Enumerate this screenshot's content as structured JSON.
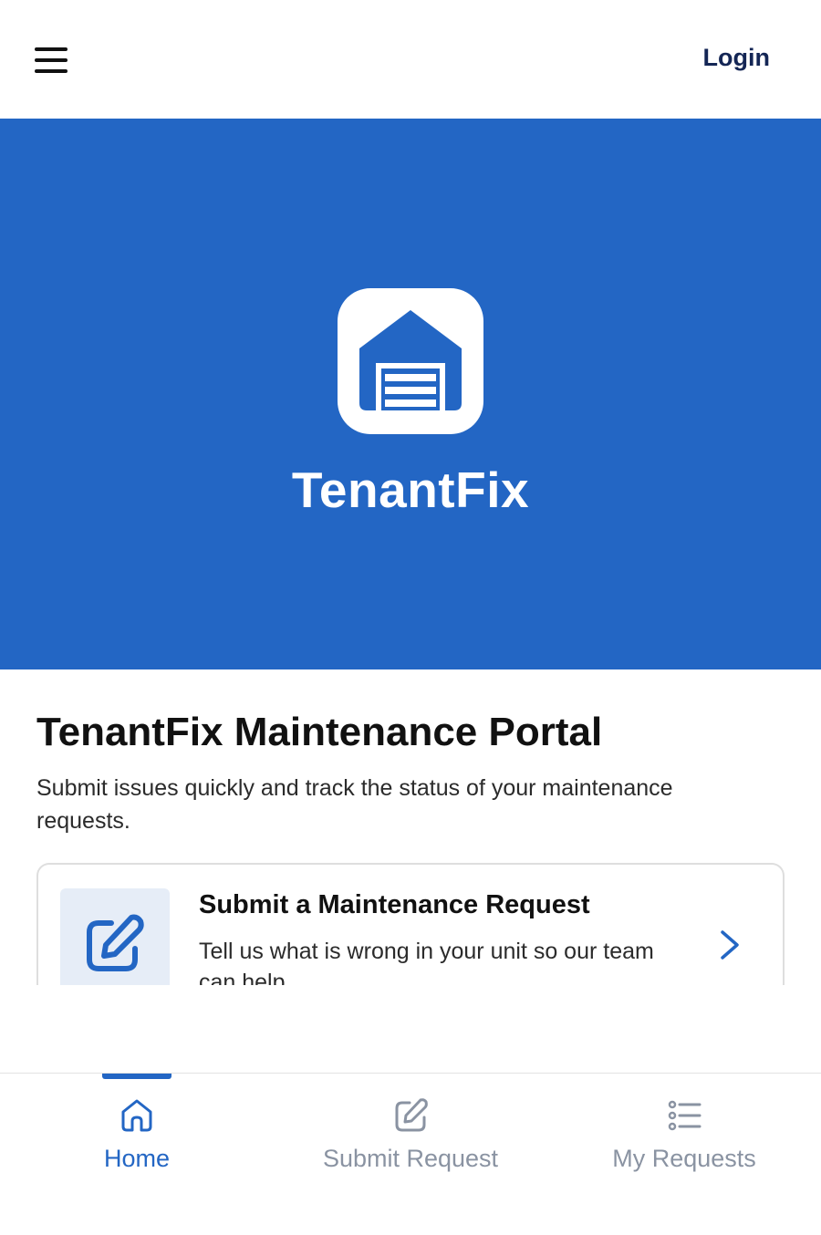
{
  "header": {
    "login_label": "Login"
  },
  "hero": {
    "brand_name": "TenantFix",
    "bg_color": "#2366c4"
  },
  "main": {
    "title": "TenantFix Maintenance Portal",
    "subtitle": "Submit issues quickly and track the status of your maintenance requests."
  },
  "card": {
    "title": "Submit a Maintenance Request",
    "description": "Tell us what is wrong in your unit so our team can help."
  },
  "bottom_nav": {
    "items": [
      {
        "label": "Home",
        "icon": "home-icon",
        "active": true
      },
      {
        "label": "Submit Request",
        "icon": "edit-icon",
        "active": false
      },
      {
        "label": "My Requests",
        "icon": "list-icon",
        "active": false
      }
    ]
  },
  "colors": {
    "accent": "#2366c4",
    "inactive": "#8a93a2",
    "login_text": "#142655"
  }
}
